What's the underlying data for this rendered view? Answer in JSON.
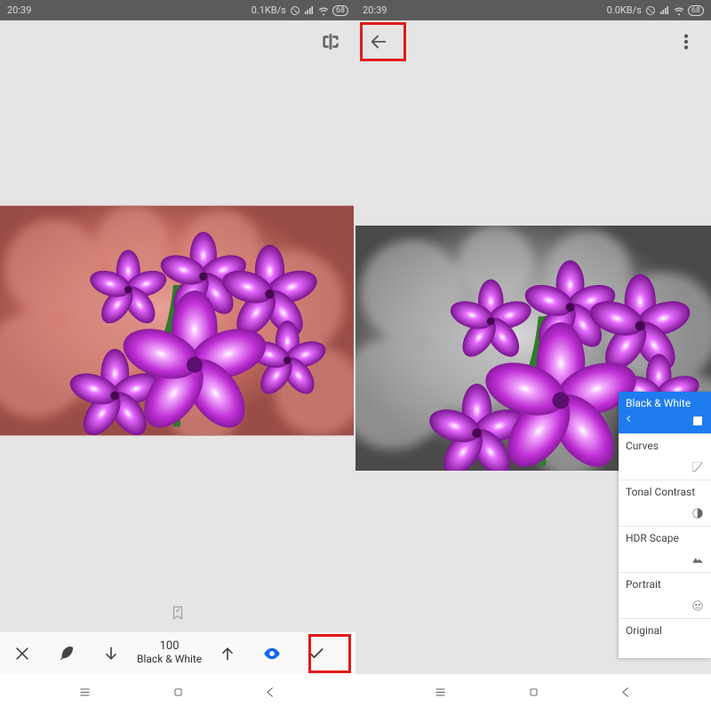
{
  "left": {
    "status": {
      "time": "20:39",
      "net": "0.1KB/s",
      "battery": "68"
    },
    "toolbar": {
      "value": "100",
      "label": "Black & White"
    }
  },
  "right": {
    "status": {
      "time": "20:39",
      "net": "0.0KB/s",
      "battery": "68"
    },
    "filters": [
      {
        "label": "Black & White",
        "active": true,
        "icon": "bw"
      },
      {
        "label": "Curves",
        "active": false,
        "icon": "curves"
      },
      {
        "label": "Tonal Contrast",
        "active": false,
        "icon": "contrast"
      },
      {
        "label": "HDR Scape",
        "active": false,
        "icon": "hdr"
      },
      {
        "label": "Portrait",
        "active": false,
        "icon": "portrait"
      },
      {
        "label": "Original",
        "active": false,
        "icon": ""
      }
    ]
  }
}
